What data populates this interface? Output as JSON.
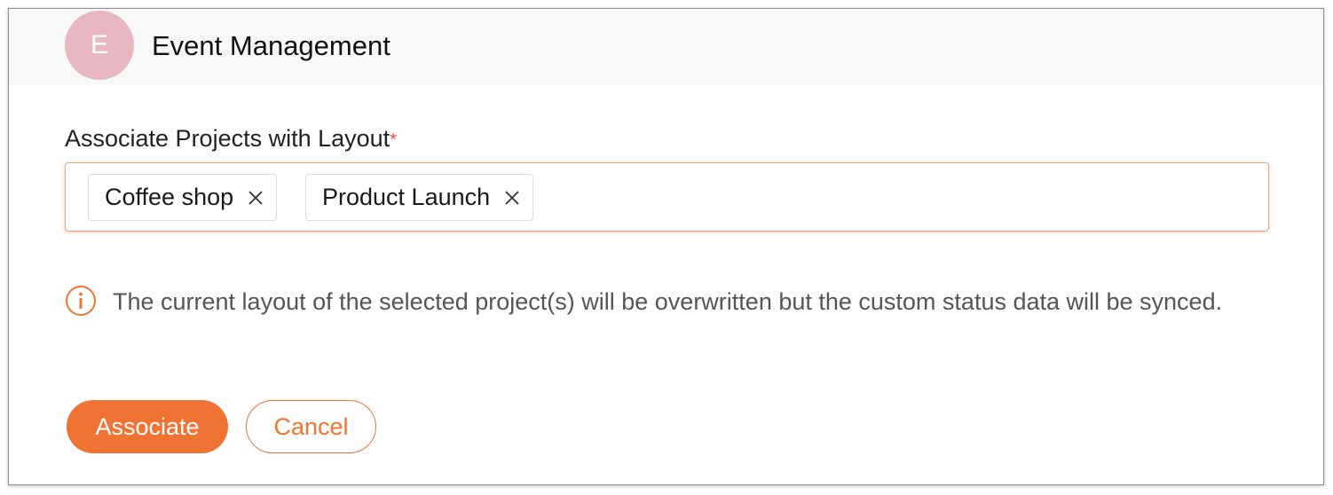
{
  "header": {
    "avatar_letter": "E",
    "title": "Event Management"
  },
  "form": {
    "label": "Associate Projects with Layout",
    "required_marker": "*",
    "selected_projects": [
      {
        "label": "Coffee shop"
      },
      {
        "label": "Product Launch"
      }
    ]
  },
  "notice": {
    "icon": "info-icon",
    "text": "The current layout of the selected project(s) will be overwritten but the custom status data will be synced."
  },
  "actions": {
    "associate_label": "Associate",
    "cancel_label": "Cancel"
  },
  "colors": {
    "accent": "#ef7333",
    "avatar_bg": "#e8b7c1",
    "required": "#e0503a"
  }
}
